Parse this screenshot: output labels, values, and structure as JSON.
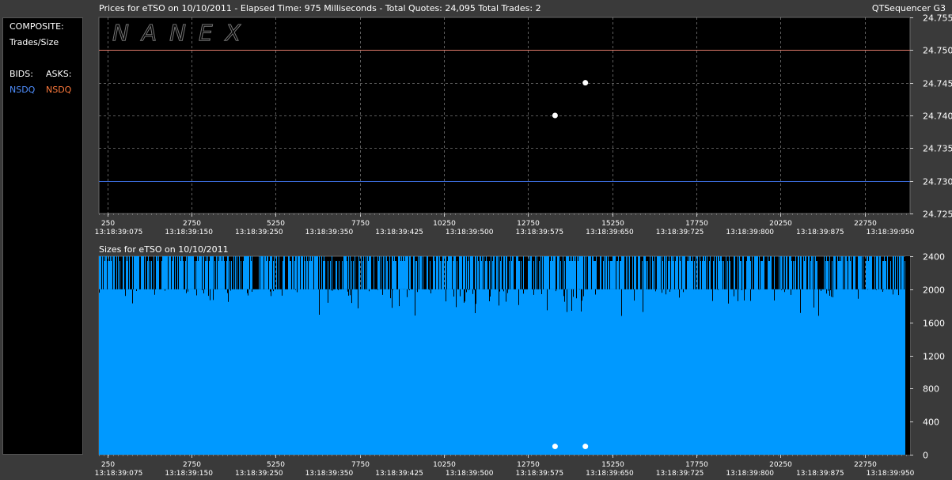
{
  "header": {
    "title": "Prices for  eTSO  on  10/10/2011  -  Elapsed Time: 975 Milliseconds  -  Total Quotes: 24,095  Total Trades: 2",
    "app_name": "QTSequencer G3",
    "sizes_title": "Sizes for  eTSO  on 10/10/2011",
    "watermark": "NANEX"
  },
  "sidebar": {
    "composite": "COMPOSITE:",
    "trades_size": "Trades/Size",
    "bids_label": "BIDS:",
    "asks_label": "ASKS:",
    "bid_exchange": "NSDQ",
    "ask_exchange": "NSDQ"
  },
  "colors": {
    "background": "#000000",
    "bid": "#4f8fff",
    "ask": "#ff7a3c",
    "ask_line": "#e07a6a",
    "bid_line": "#3a6ad8",
    "size_fill": "#0099ff",
    "trade": "#ffffff",
    "grid": "#aaaaaa"
  },
  "chart_data": [
    {
      "type": "line",
      "name": "prices",
      "ylim": [
        24.725,
        24.755
      ],
      "y_ticks": [
        "24.725",
        "24.730",
        "24.735",
        "24.740",
        "24.745",
        "24.750",
        "24.755"
      ],
      "xlim": [
        0,
        24095
      ],
      "x_ticks_seq": [
        "250",
        "2750",
        "5250",
        "7750",
        "10250",
        "12750",
        "15250",
        "17750",
        "20250",
        "22750"
      ],
      "x_ticks_time": [
        "13:18:39:075",
        "13:18:39:150",
        "13:18:39:250",
        "13:18:39:350",
        "13:18:39:425",
        "13:18:39:500",
        "13:18:39:575",
        "13:18:39:650",
        "13:18:39:725",
        "13:18:39:800",
        "13:18:39:875",
        "13:18:39:950"
      ],
      "series": [
        {
          "name": "NSDQ",
          "role": "ask",
          "values": [
            24.75
          ]
        },
        {
          "name": "NSDQ",
          "role": "bid",
          "values": [
            24.73
          ]
        }
      ],
      "trades": [
        {
          "x": 13550,
          "y": 24.74
        },
        {
          "x": 14450,
          "y": 24.745
        }
      ],
      "grid": true
    },
    {
      "type": "area",
      "name": "sizes",
      "ylim": [
        0,
        2400
      ],
      "y_ticks": [
        "0",
        "400",
        "800",
        "1200",
        "1600",
        "2000",
        "2400"
      ],
      "xlim": [
        0,
        24095
      ],
      "x_ticks_seq": [
        "250",
        "2750",
        "5250",
        "7750",
        "10250",
        "12750",
        "15250",
        "17750",
        "20250",
        "22750"
      ],
      "x_ticks_time": [
        "13:18:39:075",
        "13:18:39:150",
        "13:18:39:250",
        "13:18:39:350",
        "13:18:39:425",
        "13:18:39:500",
        "13:18:39:575",
        "13:18:39:650",
        "13:18:39:725",
        "13:18:39:800",
        "13:18:39:875",
        "13:18:39:950"
      ],
      "typical_size": 2000,
      "max_size": 2400,
      "trades": [
        {
          "x": 13550,
          "y": 100
        },
        {
          "x": 14450,
          "y": 100
        }
      ],
      "grid": true
    }
  ]
}
